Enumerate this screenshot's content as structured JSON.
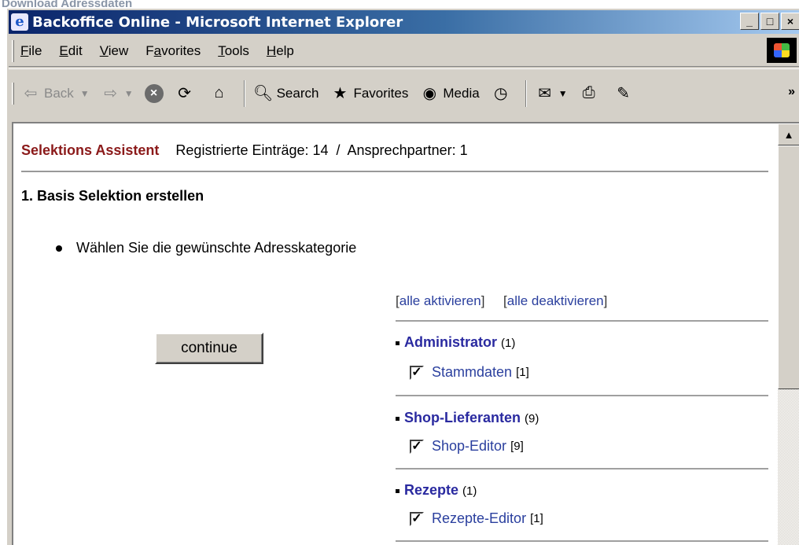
{
  "caption": "Download Adressdaten",
  "window": {
    "title": "Backoffice Online - Microsoft Internet Explorer",
    "controls": [
      "_",
      "□",
      "×"
    ]
  },
  "menu": {
    "items": [
      {
        "label": "File",
        "underline": "F",
        "rest": "ile"
      },
      {
        "label": "Edit",
        "underline": "E",
        "rest": "dit"
      },
      {
        "label": "View",
        "underline": "V",
        "rest": "iew"
      },
      {
        "label": "Favorites",
        "pre": "F",
        "underline": "a",
        "rest": "vorites"
      },
      {
        "label": "Tools",
        "underline": "T",
        "rest": "ools"
      },
      {
        "label": "Help",
        "underline": "H",
        "rest": "elp"
      }
    ]
  },
  "toolbar": {
    "back": "Back",
    "search": "Search",
    "favorites": "Favorites",
    "media": "Media",
    "more": "»"
  },
  "page": {
    "header_title": "Selektions Assistent",
    "header_stats": "Registrierte Einträge: 14  /  Ansprechpartner: 1",
    "step_title": "1. Basis Selektion erstellen",
    "instruction": "Wählen Sie die gewünschte Adresskategorie",
    "continue_label": "continue",
    "activate_all": "alle aktivieren",
    "deactivate_all": "alle deaktivieren",
    "categories": [
      {
        "name": "Administrator",
        "count": "(1)",
        "sub": "Stammdaten",
        "sub_count": "[1]",
        "checked": true
      },
      {
        "name": "Shop-Lieferanten",
        "count": "(9)",
        "sub": "Shop-Editor",
        "sub_count": "[9]",
        "checked": true
      },
      {
        "name": "Rezepte",
        "count": "(1)",
        "sub": "Rezepte-Editor",
        "sub_count": "[1]",
        "checked": true
      }
    ]
  }
}
